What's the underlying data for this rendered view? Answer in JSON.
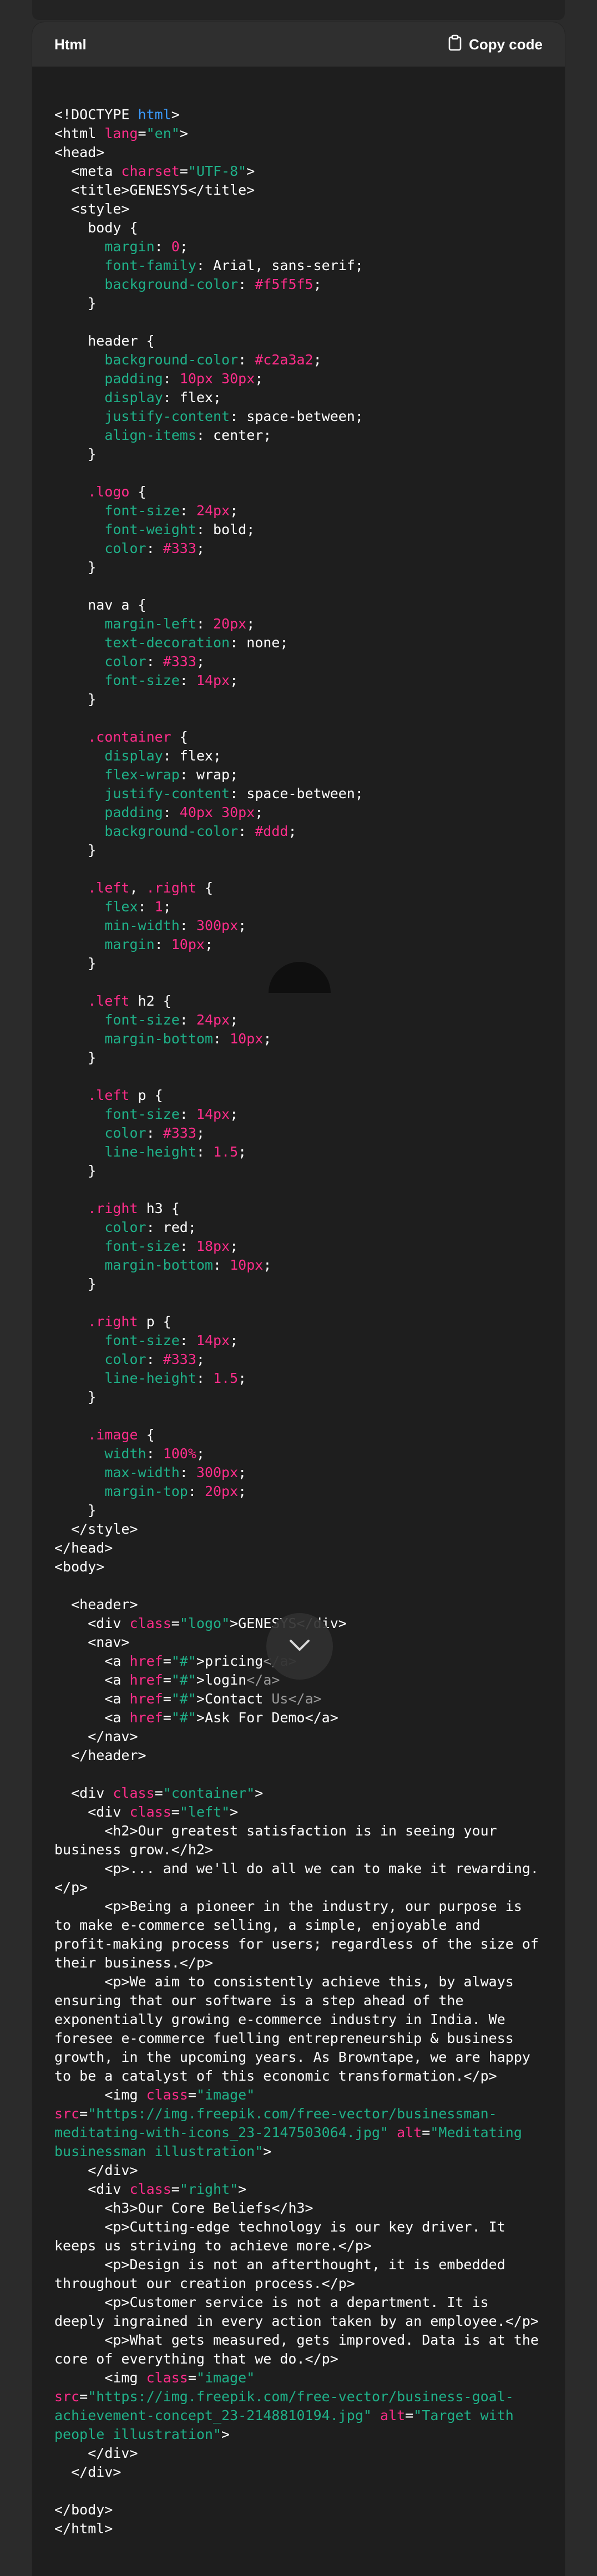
{
  "panel": {
    "language_label": "Html",
    "copy_label": "Copy code"
  },
  "icons": {
    "copy": "clipboard-icon",
    "scroll": "chevron-down-icon"
  },
  "colors": {
    "tag": "#ffffff",
    "keyword": "#3b9cff",
    "attribute": "#ff2d8a",
    "string": "#1fb088",
    "number": "#ff2d8a",
    "property": "#1fb088",
    "selector": "#ff2d8a",
    "background": "#1e1e1e",
    "header": "#2f2f2f"
  },
  "code_lines": [
    [
      [
        "plain",
        "<!DOCTYPE "
      ],
      [
        "kw",
        "html"
      ],
      [
        "plain",
        ">"
      ]
    ],
    [
      [
        "plain",
        "<html "
      ],
      [
        "attr",
        "lang"
      ],
      [
        "plain",
        "="
      ],
      [
        "str",
        "\"en\""
      ],
      [
        "plain",
        ">"
      ]
    ],
    [
      [
        "plain",
        "<head>"
      ]
    ],
    [
      [
        "plain",
        "  <meta "
      ],
      [
        "attr",
        "charset"
      ],
      [
        "plain",
        "="
      ],
      [
        "str",
        "\"UTF-8\""
      ],
      [
        "plain",
        ">"
      ]
    ],
    [
      [
        "plain",
        "  <title>GENESYS</title>"
      ]
    ],
    [
      [
        "plain",
        "  <style>"
      ]
    ],
    [
      [
        "plain",
        "    body {"
      ]
    ],
    [
      [
        "prop",
        "      margin"
      ],
      [
        "plain",
        ": "
      ],
      [
        "num",
        "0"
      ],
      [
        "plain",
        ";"
      ]
    ],
    [
      [
        "prop",
        "      font-family"
      ],
      [
        "plain",
        ": Arial, sans-serif;"
      ]
    ],
    [
      [
        "prop",
        "      background-color"
      ],
      [
        "plain",
        ": "
      ],
      [
        "num",
        "#f5f5f5"
      ],
      [
        "plain",
        ";"
      ]
    ],
    [
      [
        "plain",
        "    }"
      ]
    ],
    [
      [
        "plain",
        ""
      ]
    ],
    [
      [
        "plain",
        "    header {"
      ]
    ],
    [
      [
        "prop",
        "      background-color"
      ],
      [
        "plain",
        ": "
      ],
      [
        "num",
        "#c2a3a2"
      ],
      [
        "plain",
        ";"
      ]
    ],
    [
      [
        "prop",
        "      padding"
      ],
      [
        "plain",
        ": "
      ],
      [
        "num",
        "10px 30px"
      ],
      [
        "plain",
        ";"
      ]
    ],
    [
      [
        "prop",
        "      display"
      ],
      [
        "plain",
        ": flex;"
      ]
    ],
    [
      [
        "prop",
        "      justify-content"
      ],
      [
        "plain",
        ": space-between;"
      ]
    ],
    [
      [
        "prop",
        "      align-items"
      ],
      [
        "plain",
        ": center;"
      ]
    ],
    [
      [
        "plain",
        "    }"
      ]
    ],
    [
      [
        "plain",
        ""
      ]
    ],
    [
      [
        "sel",
        "    .logo"
      ],
      [
        "plain",
        " {"
      ]
    ],
    [
      [
        "prop",
        "      font-size"
      ],
      [
        "plain",
        ": "
      ],
      [
        "num",
        "24px"
      ],
      [
        "plain",
        ";"
      ]
    ],
    [
      [
        "prop",
        "      font-weight"
      ],
      [
        "plain",
        ": bold;"
      ]
    ],
    [
      [
        "prop",
        "      color"
      ],
      [
        "plain",
        ": "
      ],
      [
        "num",
        "#333"
      ],
      [
        "plain",
        ";"
      ]
    ],
    [
      [
        "plain",
        "    }"
      ]
    ],
    [
      [
        "plain",
        ""
      ]
    ],
    [
      [
        "plain",
        "    nav a {"
      ]
    ],
    [
      [
        "prop",
        "      margin-left"
      ],
      [
        "plain",
        ": "
      ],
      [
        "num",
        "20px"
      ],
      [
        "plain",
        ";"
      ]
    ],
    [
      [
        "prop",
        "      text-decoration"
      ],
      [
        "plain",
        ": none;"
      ]
    ],
    [
      [
        "prop",
        "      color"
      ],
      [
        "plain",
        ": "
      ],
      [
        "num",
        "#333"
      ],
      [
        "plain",
        ";"
      ]
    ],
    [
      [
        "prop",
        "      font-size"
      ],
      [
        "plain",
        ": "
      ],
      [
        "num",
        "14px"
      ],
      [
        "plain",
        ";"
      ]
    ],
    [
      [
        "plain",
        "    }"
      ]
    ],
    [
      [
        "plain",
        ""
      ]
    ],
    [
      [
        "sel",
        "    .container"
      ],
      [
        "plain",
        " {"
      ]
    ],
    [
      [
        "prop",
        "      display"
      ],
      [
        "plain",
        ": flex;"
      ]
    ],
    [
      [
        "prop",
        "      flex-wrap"
      ],
      [
        "plain",
        ": wrap;"
      ]
    ],
    [
      [
        "prop",
        "      justify-content"
      ],
      [
        "plain",
        ": space-between;"
      ]
    ],
    [
      [
        "prop",
        "      padding"
      ],
      [
        "plain",
        ": "
      ],
      [
        "num",
        "40px 30px"
      ],
      [
        "plain",
        ";"
      ]
    ],
    [
      [
        "prop",
        "      background-color"
      ],
      [
        "plain",
        ": "
      ],
      [
        "num",
        "#ddd"
      ],
      [
        "plain",
        ";"
      ]
    ],
    [
      [
        "plain",
        "    }"
      ]
    ],
    [
      [
        "plain",
        ""
      ]
    ],
    [
      [
        "sel",
        "    .left"
      ],
      [
        "plain",
        ", "
      ],
      [
        "sel",
        ".right"
      ],
      [
        "plain",
        " {"
      ]
    ],
    [
      [
        "prop",
        "      flex"
      ],
      [
        "plain",
        ": "
      ],
      [
        "num",
        "1"
      ],
      [
        "plain",
        ";"
      ]
    ],
    [
      [
        "prop",
        "      min-width"
      ],
      [
        "plain",
        ": "
      ],
      [
        "num",
        "300px"
      ],
      [
        "plain",
        ";"
      ]
    ],
    [
      [
        "prop",
        "      margin"
      ],
      [
        "plain",
        ": "
      ],
      [
        "num",
        "10px"
      ],
      [
        "plain",
        ";"
      ]
    ],
    [
      [
        "plain",
        "    }"
      ]
    ],
    [
      [
        "plain",
        ""
      ]
    ],
    [
      [
        "sel",
        "    .left"
      ],
      [
        "plain",
        " h2 {"
      ]
    ],
    [
      [
        "prop",
        "      font-size"
      ],
      [
        "plain",
        ": "
      ],
      [
        "num",
        "24px"
      ],
      [
        "plain",
        ";"
      ]
    ],
    [
      [
        "prop",
        "      margin-bottom"
      ],
      [
        "plain",
        ": "
      ],
      [
        "num",
        "10px"
      ],
      [
        "plain",
        ";"
      ]
    ],
    [
      [
        "plain",
        "    }"
      ]
    ],
    [
      [
        "plain",
        ""
      ]
    ],
    [
      [
        "sel",
        "    .left"
      ],
      [
        "plain",
        " p {"
      ]
    ],
    [
      [
        "prop",
        "      font-size"
      ],
      [
        "plain",
        ": "
      ],
      [
        "num",
        "14px"
      ],
      [
        "plain",
        ";"
      ]
    ],
    [
      [
        "prop",
        "      color"
      ],
      [
        "plain",
        ": "
      ],
      [
        "num",
        "#333"
      ],
      [
        "plain",
        ";"
      ]
    ],
    [
      [
        "prop",
        "      line-height"
      ],
      [
        "plain",
        ": "
      ],
      [
        "num",
        "1.5"
      ],
      [
        "plain",
        ";"
      ]
    ],
    [
      [
        "plain",
        "    }"
      ]
    ],
    [
      [
        "plain",
        ""
      ]
    ],
    [
      [
        "sel",
        "    .right"
      ],
      [
        "plain",
        " h3 {"
      ]
    ],
    [
      [
        "prop",
        "      color"
      ],
      [
        "plain",
        ": red;"
      ]
    ],
    [
      [
        "prop",
        "      font-size"
      ],
      [
        "plain",
        ": "
      ],
      [
        "num",
        "18px"
      ],
      [
        "plain",
        ";"
      ]
    ],
    [
      [
        "prop",
        "      margin-bottom"
      ],
      [
        "plain",
        ": "
      ],
      [
        "num",
        "10px"
      ],
      [
        "plain",
        ";"
      ]
    ],
    [
      [
        "plain",
        "    }"
      ]
    ],
    [
      [
        "plain",
        ""
      ]
    ],
    [
      [
        "sel",
        "    .right"
      ],
      [
        "plain",
        " p {"
      ]
    ],
    [
      [
        "prop",
        "      font-size"
      ],
      [
        "plain",
        ": "
      ],
      [
        "num",
        "14px"
      ],
      [
        "plain",
        ";"
      ]
    ],
    [
      [
        "prop",
        "      color"
      ],
      [
        "plain",
        ": "
      ],
      [
        "num",
        "#333"
      ],
      [
        "plain",
        ";"
      ]
    ],
    [
      [
        "prop",
        "      line-height"
      ],
      [
        "plain",
        ": "
      ],
      [
        "num",
        "1.5"
      ],
      [
        "plain",
        ";"
      ]
    ],
    [
      [
        "plain",
        "    }"
      ]
    ],
    [
      [
        "plain",
        ""
      ]
    ],
    [
      [
        "sel",
        "    .image"
      ],
      [
        "plain",
        " {"
      ]
    ],
    [
      [
        "prop",
        "      width"
      ],
      [
        "plain",
        ": "
      ],
      [
        "num",
        "100%"
      ],
      [
        "plain",
        ";"
      ]
    ],
    [
      [
        "prop",
        "      max-width"
      ],
      [
        "plain",
        ": "
      ],
      [
        "num",
        "300px"
      ],
      [
        "plain",
        ";"
      ]
    ],
    [
      [
        "prop",
        "      margin-top"
      ],
      [
        "plain",
        ": "
      ],
      [
        "num",
        "20px"
      ],
      [
        "plain",
        ";"
      ]
    ],
    [
      [
        "plain",
        "    }"
      ]
    ],
    [
      [
        "plain",
        "  </style>"
      ]
    ],
    [
      [
        "plain",
        "</head>"
      ]
    ],
    [
      [
        "plain",
        "<body>"
      ]
    ],
    [
      [
        "plain",
        ""
      ]
    ],
    [
      [
        "plain",
        "  <header>"
      ]
    ],
    [
      [
        "plain",
        "    <div "
      ],
      [
        "attr",
        "class"
      ],
      [
        "plain",
        "="
      ],
      [
        "str",
        "\"logo\""
      ],
      [
        "plain",
        ">GENESYS</div>"
      ]
    ],
    [
      [
        "plain",
        "    <nav>"
      ]
    ],
    [
      [
        "plain",
        "      <a "
      ],
      [
        "attr",
        "href"
      ],
      [
        "plain",
        "="
      ],
      [
        "str",
        "\"#\""
      ],
      [
        "plain",
        ">pricing"
      ],
      [
        "gray",
        "</a>"
      ]
    ],
    [
      [
        "plain",
        "      <a "
      ],
      [
        "attr",
        "href"
      ],
      [
        "plain",
        "="
      ],
      [
        "str",
        "\"#\""
      ],
      [
        "plain",
        ">login"
      ],
      [
        "gray",
        "</a>"
      ]
    ],
    [
      [
        "plain",
        "      <a "
      ],
      [
        "attr",
        "href"
      ],
      [
        "plain",
        "="
      ],
      [
        "str",
        "\"#\""
      ],
      [
        "plain",
        ">Contact "
      ],
      [
        "gray",
        "Us</a>"
      ]
    ],
    [
      [
        "plain",
        "      <a "
      ],
      [
        "attr",
        "href"
      ],
      [
        "plain",
        "="
      ],
      [
        "str",
        "\"#\""
      ],
      [
        "plain",
        ">Ask For Demo</a>"
      ]
    ],
    [
      [
        "plain",
        "    </nav>"
      ]
    ],
    [
      [
        "plain",
        "  </header>"
      ]
    ],
    [
      [
        "plain",
        ""
      ]
    ],
    [
      [
        "plain",
        "  <div "
      ],
      [
        "attr",
        "class"
      ],
      [
        "plain",
        "="
      ],
      [
        "str",
        "\"container\""
      ],
      [
        "plain",
        ">"
      ]
    ],
    [
      [
        "plain",
        "    <div "
      ],
      [
        "attr",
        "class"
      ],
      [
        "plain",
        "="
      ],
      [
        "str",
        "\"left\""
      ],
      [
        "plain",
        ">"
      ]
    ],
    [
      [
        "plain",
        "      <h2>Our greatest satisfaction is in seeing your business grow.</h2>"
      ]
    ],
    [
      [
        "plain",
        "      <p>... and we'll do all we can to make it rewarding.</p>"
      ]
    ],
    [
      [
        "plain",
        "      <p>Being a pioneer in the industry, our purpose is to make e-commerce selling, a simple, enjoyable and profit-making process for users; regardless of the size of their business.</p>"
      ]
    ],
    [
      [
        "plain",
        "      <p>We aim to consistently achieve this, by always ensuring that our software is a step ahead of the exponentially growing e-commerce industry in India. We foresee e-commerce fuelling entrepreneurship & business growth, in the upcoming years. As Browntape, we are happy to be a catalyst of this economic transformation.</p>"
      ]
    ],
    [
      [
        "plain",
        "      <img "
      ],
      [
        "attr",
        "class"
      ],
      [
        "plain",
        "="
      ],
      [
        "str",
        "\"image\""
      ],
      [
        "plain",
        " "
      ],
      [
        "attr",
        "src"
      ],
      [
        "plain",
        "="
      ],
      [
        "str",
        "\"https://img.freepik.com/free-vector/businessman-meditating-with-icons_23-2147503064.jpg\""
      ],
      [
        "plain",
        " "
      ],
      [
        "attr",
        "alt"
      ],
      [
        "plain",
        "="
      ],
      [
        "str",
        "\"Meditating businessman illustration\""
      ],
      [
        "plain",
        ">"
      ]
    ],
    [
      [
        "plain",
        "    </div>"
      ]
    ],
    [
      [
        "plain",
        "    <div "
      ],
      [
        "attr",
        "class"
      ],
      [
        "plain",
        "="
      ],
      [
        "str",
        "\"right\""
      ],
      [
        "plain",
        ">"
      ]
    ],
    [
      [
        "plain",
        "      <h3>Our Core Beliefs</h3>"
      ]
    ],
    [
      [
        "plain",
        "      <p>Cutting-edge technology is our key driver. It keeps us striving to achieve more.</p>"
      ]
    ],
    [
      [
        "plain",
        "      <p>Design is not an afterthought, it is embedded throughout our creation process.</p>"
      ]
    ],
    [
      [
        "plain",
        "      <p>Customer service is not a department. It is deeply ingrained in every action taken by an employee.</p>"
      ]
    ],
    [
      [
        "plain",
        "      <p>What gets measured, gets improved. Data is at the core of everything that we do.</p>"
      ]
    ],
    [
      [
        "plain",
        "      <img "
      ],
      [
        "attr",
        "class"
      ],
      [
        "plain",
        "="
      ],
      [
        "str",
        "\"image\""
      ],
      [
        "plain",
        " "
      ],
      [
        "attr",
        "src"
      ],
      [
        "plain",
        "="
      ],
      [
        "str",
        "\"https://img.freepik.com/free-vector/business-goal-achievement-concept_23-2148810194.jpg\""
      ],
      [
        "plain",
        " "
      ],
      [
        "attr",
        "alt"
      ],
      [
        "plain",
        "="
      ],
      [
        "str",
        "\"Target with people illustration\""
      ],
      [
        "plain",
        ">"
      ]
    ],
    [
      [
        "plain",
        "    </div>"
      ]
    ],
    [
      [
        "plain",
        "  </div>"
      ]
    ],
    [
      [
        "plain",
        ""
      ]
    ],
    [
      [
        "plain",
        "</body>"
      ]
    ],
    [
      [
        "plain",
        "</html>"
      ]
    ]
  ]
}
